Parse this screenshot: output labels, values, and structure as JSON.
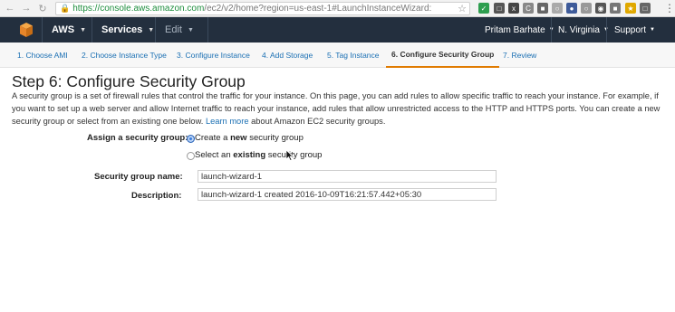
{
  "browser": {
    "back_icon": "back-arrow-icon",
    "forward_icon": "forward-arrow-icon",
    "reload_icon": "reload-icon",
    "url_host": "https://console.aws.amazon.com",
    "url_rest": "/ec2/v2/home?region=us-east-1#LaunchInstanceWizard:"
  },
  "awsbar": {
    "logo": "AWS",
    "services": "Services",
    "edit": "Edit",
    "user": "Pritam Barhate",
    "region": "N. Virginia",
    "support": "Support"
  },
  "tabs": [
    {
      "label": "1. Choose AMI"
    },
    {
      "label": "2. Choose Instance Type"
    },
    {
      "label": "3. Configure Instance"
    },
    {
      "label": "4. Add Storage"
    },
    {
      "label": "5. Tag Instance"
    },
    {
      "label": "6. Configure Security Group"
    },
    {
      "label": "7. Review"
    }
  ],
  "page": {
    "title": "Step 6: Configure Security Group",
    "desc_text": "A security group is a set of firewall rules that control the traffic for your instance. On this page, you can add rules to allow specific traffic to reach your instance. For example, if you want to set up a web server and allow Internet traffic to reach your instance, add rules that allow unrestricted access to the HTTP and HTTPS ports. You can create a new security group or select from an existing one below.",
    "learn_more": "Learn more",
    "desc_tail": "about Amazon EC2 security groups."
  },
  "form": {
    "assign_label": "Assign a security group:",
    "opt_create_pre": "Create a ",
    "opt_create_bold": "new",
    "opt_create_post": " security group",
    "opt_select_pre": "Select an ",
    "opt_select_bold": "existing",
    "opt_select_post": " security group",
    "name_label": "Security group name:",
    "name_value": "launch-wizard-1",
    "desc_label": "Description:",
    "desc_value": "launch-wizard-1 created 2016-10-09T16:21:57.442+05:30"
  }
}
